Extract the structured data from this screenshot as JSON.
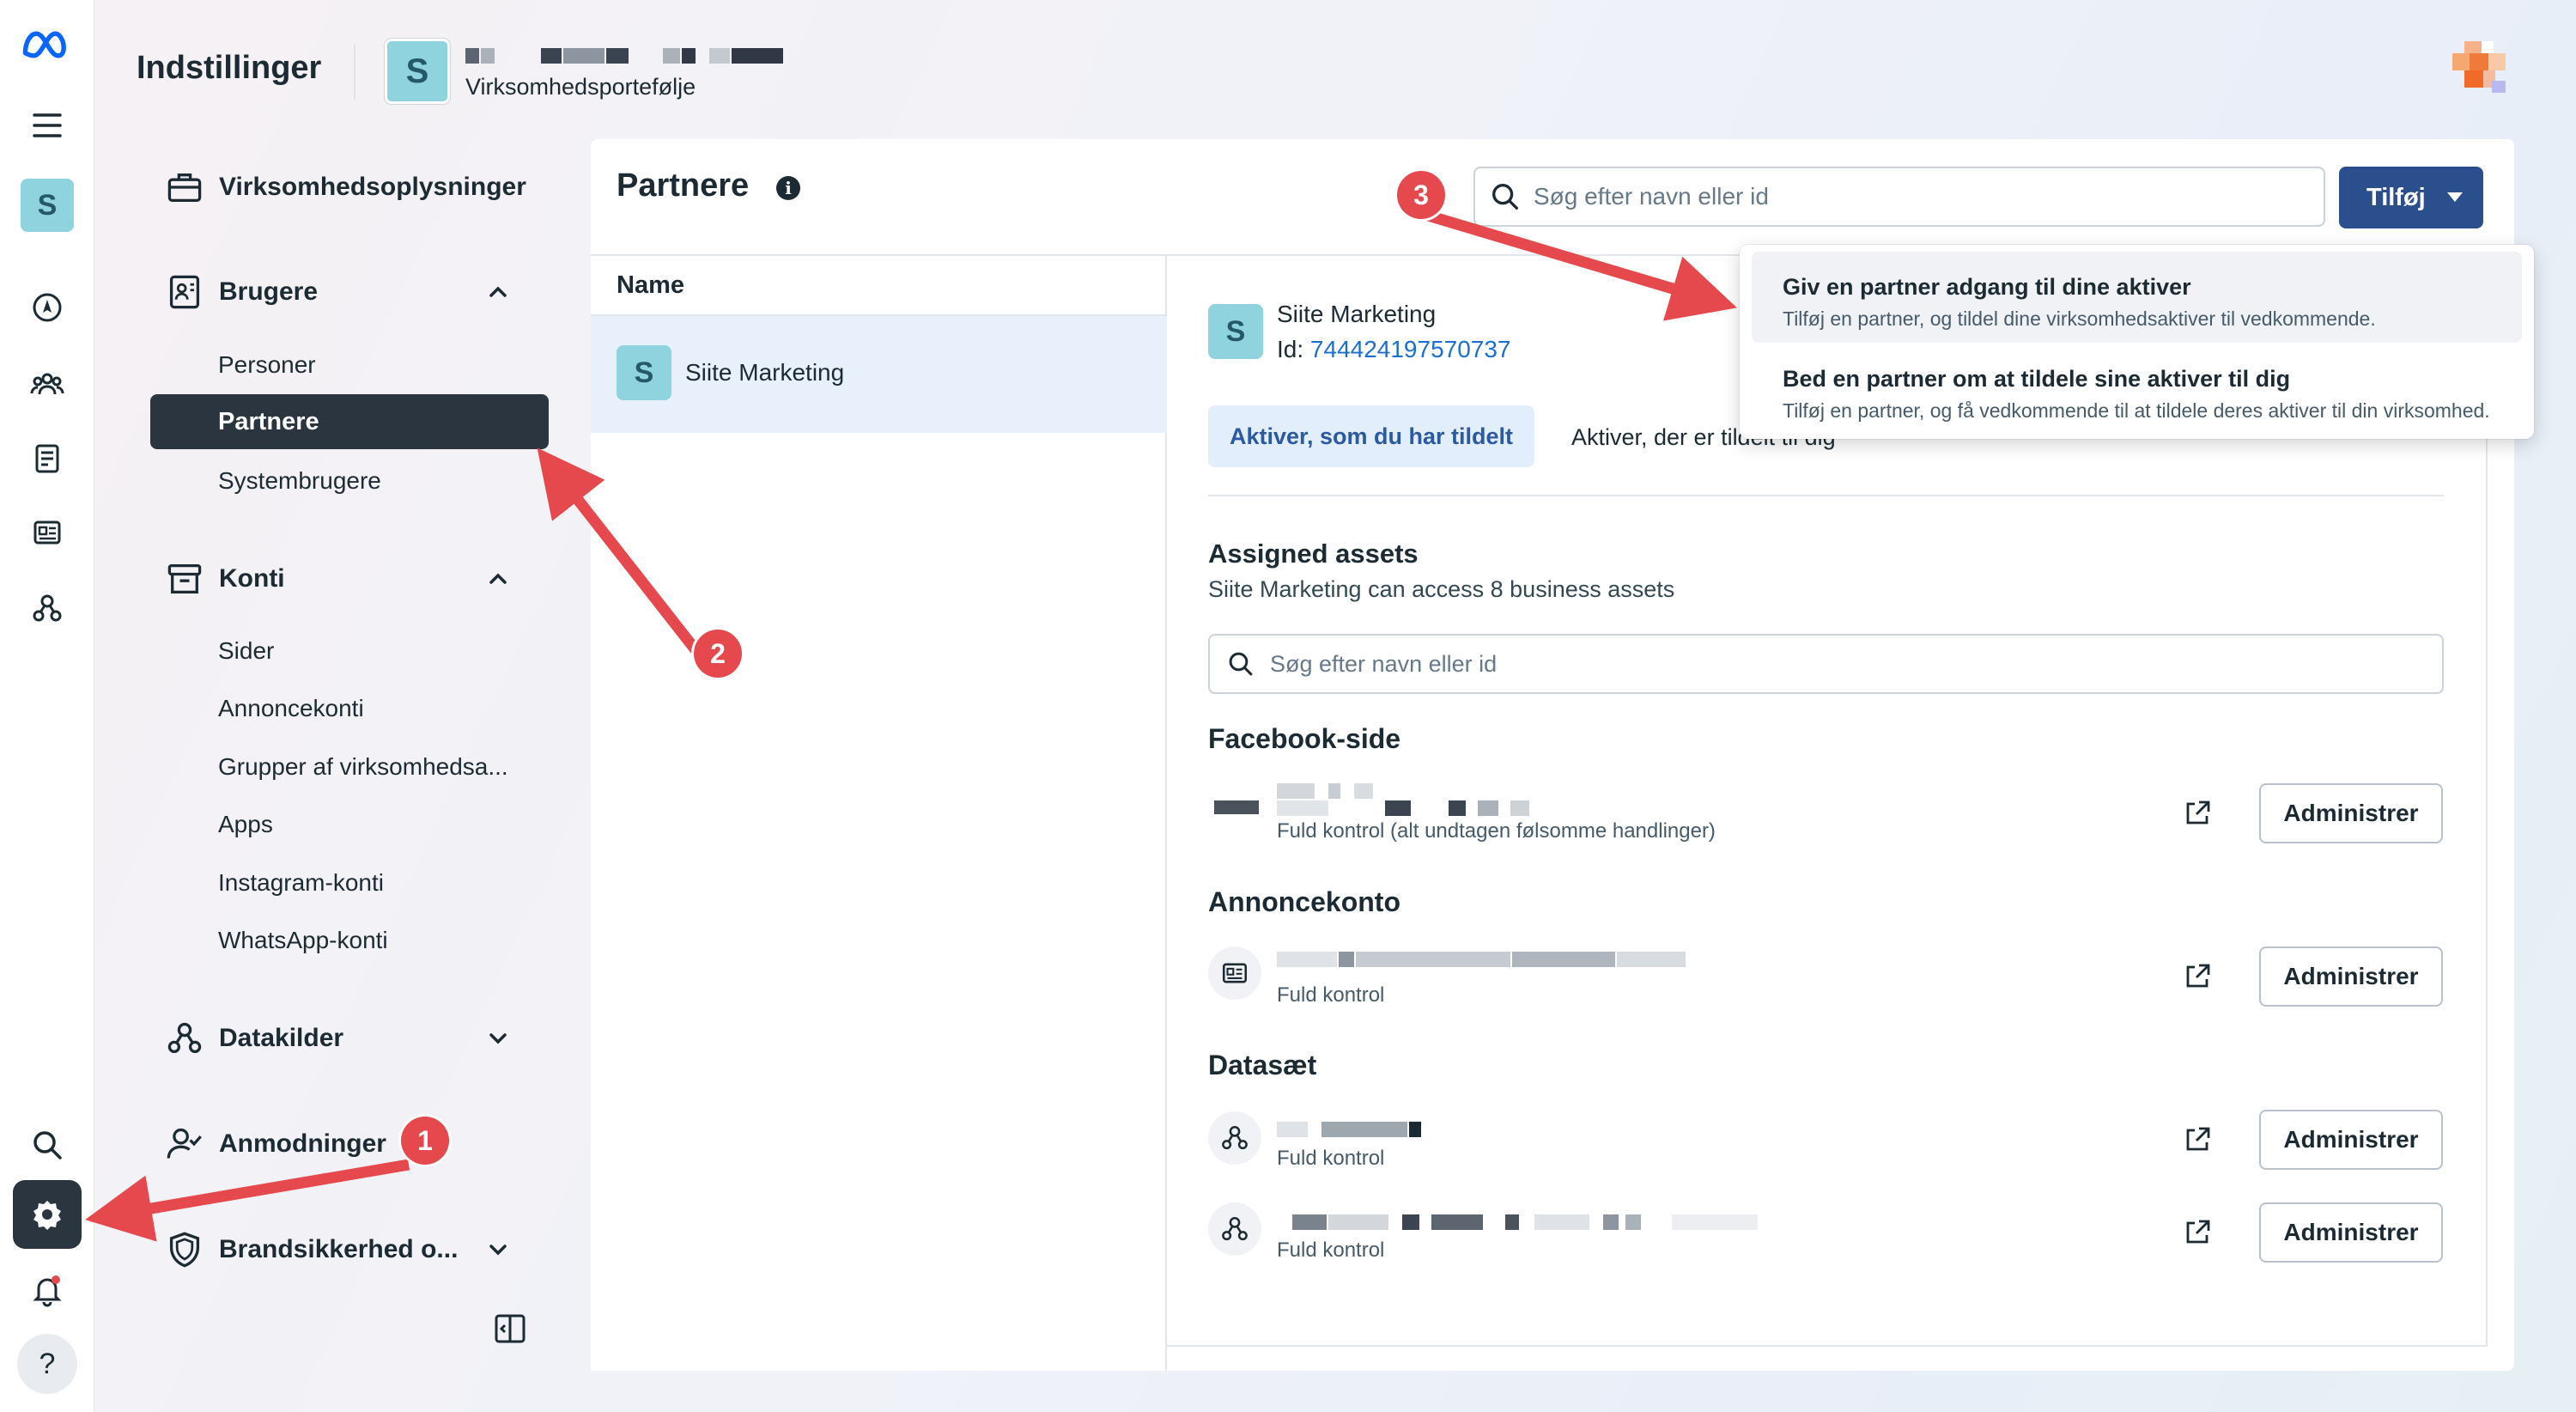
{
  "header": {
    "app_title": "Indstillinger",
    "portfolio_initial": "S",
    "portfolio_subtitle": "Virksomhedsportefølje"
  },
  "rail": {
    "avatar_initial": "S",
    "help_label": "?"
  },
  "sidebar": {
    "business_info": "Virksomhedsoplysninger",
    "users": {
      "label": "Brugere",
      "items": [
        "Personer",
        "Partnere",
        "Systembrugere"
      ]
    },
    "accounts": {
      "label": "Konti",
      "items": [
        "Sider",
        "Annoncekonti",
        "Grupper af virksomhedsa...",
        "Apps",
        "Instagram-konti",
        "WhatsApp-konti"
      ]
    },
    "data_sources": "Datakilder",
    "requests": "Anmodninger",
    "brand_safety": "Brandsikkerhed o..."
  },
  "main": {
    "title": "Partnere",
    "search_placeholder": "Søg efter navn eller id",
    "add_button": "Tilføj",
    "list_header": "Name",
    "partners": [
      {
        "initial": "S",
        "name": "Siite Marketing"
      }
    ]
  },
  "detail": {
    "partner_initial": "S",
    "partner_name": "Siite Marketing",
    "id_label": "Id:",
    "id_value": "744424197570737",
    "tabs": [
      "Aktiver, som du har tildelt",
      "Aktiver, der er tildelt til dig"
    ],
    "assigned_title": "Assigned assets",
    "assigned_subtitle": "Siite Marketing can access 8 business assets",
    "asset_search_placeholder": "Søg efter navn eller id",
    "sections": [
      {
        "title": "Facebook-side",
        "rows": [
          {
            "permission": "Fuld kontrol (alt undtagen følsomme handlinger)",
            "action": "Administrer"
          }
        ]
      },
      {
        "title": "Annoncekonto",
        "rows": [
          {
            "permission": "Fuld kontrol",
            "action": "Administrer"
          }
        ]
      },
      {
        "title": "Datasæt",
        "rows": [
          {
            "permission": "Fuld kontrol",
            "action": "Administrer"
          },
          {
            "permission": "Fuld kontrol",
            "action": "Administrer"
          }
        ]
      }
    ]
  },
  "dropdown": {
    "options": [
      {
        "title": "Giv en partner adgang til dine aktiver",
        "desc": "Tilføj en partner, og tildel dine virksomhedsaktiver til vedkommende."
      },
      {
        "title": "Bed en partner om at tildele sine aktiver til dig",
        "desc": "Tilføj en partner, og få vedkommende til at tildele deres aktiver til din virksomhed."
      }
    ]
  },
  "annotations": [
    "1",
    "2",
    "3"
  ],
  "colors": {
    "accent": "#2b4f8c",
    "selected_nav": "#2b3540",
    "link": "#1a6fd1",
    "annotation": "#e5484d",
    "avatar": "#8fd3de"
  }
}
